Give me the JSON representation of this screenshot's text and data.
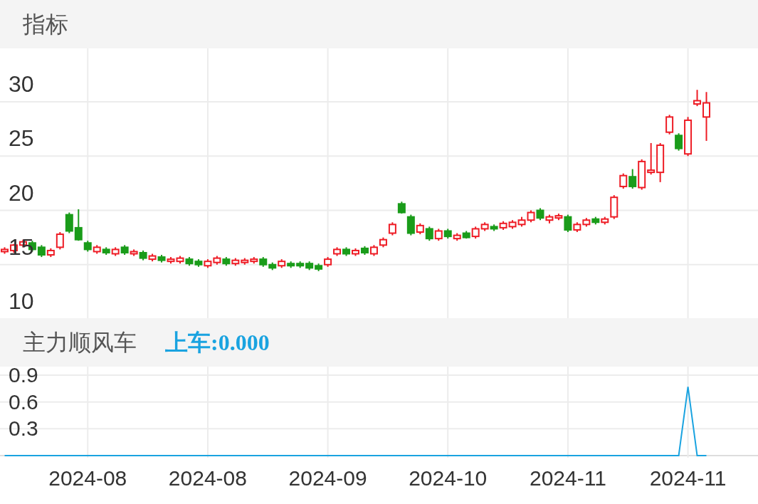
{
  "main_panel": {
    "title": "指标",
    "chart_data": {
      "type": "candlestick",
      "ylim": [
        10,
        30
      ],
      "yticks": [
        30,
        25,
        20,
        15,
        10
      ],
      "grid": true,
      "categories": [
        null,
        null,
        null,
        null,
        null,
        null,
        null,
        null,
        null,
        null,
        null,
        null,
        null,
        null,
        null,
        null,
        null,
        null,
        null,
        null,
        null,
        null,
        null,
        null,
        null,
        null,
        null,
        null,
        null,
        null,
        null,
        null,
        null,
        null,
        null,
        null,
        null,
        null,
        null,
        null,
        null,
        null,
        null,
        null,
        null,
        null,
        null,
        null,
        null,
        null,
        null,
        null,
        null,
        null,
        null,
        null,
        null,
        null,
        null,
        null,
        null,
        null,
        null,
        null,
        null,
        null,
        null,
        null,
        null,
        null,
        null,
        null,
        null,
        null,
        null,
        null,
        null
      ],
      "ohlc": [
        [
          16.2,
          16.6,
          16.0,
          16.4
        ],
        [
          16.3,
          16.9,
          16.1,
          16.8
        ],
        [
          16.8,
          17.3,
          16.6,
          17.1
        ],
        [
          17.0,
          17.2,
          16.2,
          16.4
        ],
        [
          16.6,
          16.8,
          15.7,
          15.9
        ],
        [
          15.9,
          16.5,
          15.7,
          16.3
        ],
        [
          16.6,
          18.0,
          16.4,
          17.8
        ],
        [
          19.6,
          19.8,
          17.9,
          18.1
        ],
        [
          18.4,
          20.1,
          17.2,
          17.3
        ],
        [
          17.0,
          17.2,
          16.2,
          16.4
        ],
        [
          16.2,
          16.8,
          16.0,
          16.6
        ],
        [
          16.4,
          16.6,
          15.9,
          16.1
        ],
        [
          16.0,
          16.6,
          15.8,
          16.4
        ],
        [
          16.6,
          16.8,
          15.9,
          16.1
        ],
        [
          16.0,
          16.4,
          15.8,
          16.2
        ],
        [
          16.1,
          16.3,
          15.4,
          15.6
        ],
        [
          15.5,
          16.0,
          15.3,
          15.8
        ],
        [
          15.7,
          15.9,
          15.2,
          15.4
        ],
        [
          15.3,
          15.7,
          15.1,
          15.5
        ],
        [
          15.3,
          15.8,
          15.1,
          15.6
        ],
        [
          15.5,
          15.7,
          14.9,
          15.1
        ],
        [
          15.3,
          15.5,
          14.8,
          15.0
        ],
        [
          14.9,
          15.5,
          14.7,
          15.3
        ],
        [
          15.2,
          15.8,
          15.0,
          15.6
        ],
        [
          15.5,
          15.7,
          14.9,
          15.1
        ],
        [
          15.1,
          15.6,
          14.9,
          15.4
        ],
        [
          15.2,
          15.6,
          15.0,
          15.4
        ],
        [
          15.3,
          15.7,
          15.1,
          15.5
        ],
        [
          15.5,
          15.7,
          14.8,
          15.0
        ],
        [
          15.0,
          15.2,
          14.5,
          14.7
        ],
        [
          14.9,
          15.5,
          14.7,
          15.3
        ],
        [
          15.1,
          15.3,
          14.7,
          14.9
        ],
        [
          15.1,
          15.3,
          14.7,
          14.9
        ],
        [
          15.1,
          15.3,
          14.5,
          14.7
        ],
        [
          14.9,
          15.1,
          14.4,
          14.6
        ],
        [
          15.0,
          15.7,
          14.8,
          15.5
        ],
        [
          16.0,
          16.6,
          15.8,
          16.4
        ],
        [
          16.4,
          16.6,
          15.8,
          16.0
        ],
        [
          16.0,
          16.5,
          15.8,
          16.3
        ],
        [
          16.5,
          16.7,
          15.9,
          16.1
        ],
        [
          16.0,
          16.8,
          15.8,
          16.6
        ],
        [
          16.8,
          17.5,
          16.6,
          17.3
        ],
        [
          17.9,
          18.9,
          17.7,
          18.7
        ],
        [
          20.6,
          20.8,
          19.7,
          19.8
        ],
        [
          19.4,
          19.6,
          17.7,
          17.9
        ],
        [
          18.0,
          18.8,
          17.8,
          18.6
        ],
        [
          18.3,
          18.5,
          17.2,
          17.4
        ],
        [
          17.4,
          18.3,
          17.2,
          18.1
        ],
        [
          18.1,
          18.3,
          17.4,
          17.6
        ],
        [
          17.4,
          17.9,
          17.2,
          17.7
        ],
        [
          17.9,
          18.1,
          17.4,
          17.5
        ],
        [
          17.6,
          18.5,
          17.4,
          18.3
        ],
        [
          18.3,
          18.9,
          18.1,
          18.7
        ],
        [
          18.5,
          18.7,
          18.1,
          18.3
        ],
        [
          18.4,
          19.0,
          18.2,
          18.8
        ],
        [
          18.5,
          19.1,
          18.3,
          18.9
        ],
        [
          18.7,
          19.4,
          18.5,
          19.1
        ],
        [
          19.1,
          20.0,
          18.9,
          19.8
        ],
        [
          20.0,
          20.2,
          19.1,
          19.3
        ],
        [
          19.1,
          19.6,
          18.8,
          19.4
        ],
        [
          19.3,
          19.7,
          19.1,
          19.5
        ],
        [
          19.4,
          19.6,
          18.0,
          18.2
        ],
        [
          18.2,
          18.9,
          18.0,
          18.7
        ],
        [
          18.7,
          19.3,
          18.5,
          19.1
        ],
        [
          19.2,
          19.4,
          18.7,
          18.9
        ],
        [
          18.9,
          19.4,
          18.7,
          19.2
        ],
        [
          19.4,
          21.4,
          19.2,
          21.2
        ],
        [
          22.2,
          23.4,
          22.0,
          23.2
        ],
        [
          23.1,
          23.8,
          22.0,
          22.2
        ],
        [
          22.1,
          24.7,
          21.9,
          24.5
        ],
        [
          23.5,
          26.2,
          23.3,
          23.7
        ],
        [
          23.5,
          26.2,
          22.6,
          26.0
        ],
        [
          27.2,
          28.8,
          27.0,
          28.6
        ],
        [
          26.9,
          27.1,
          25.5,
          25.7
        ],
        [
          25.2,
          28.6,
          25.0,
          28.3
        ],
        [
          29.8,
          31.1,
          29.6,
          30.1
        ],
        [
          28.6,
          30.9,
          26.4,
          29.9
        ]
      ]
    }
  },
  "sub_panel": {
    "title": "主力顺风车",
    "reading": "上车:0.000",
    "chart_data": {
      "type": "line",
      "ylim": [
        0,
        0.9
      ],
      "yticks": [
        0.3,
        0.6,
        0.9
      ],
      "grid": true,
      "categories": [
        null,
        null,
        null,
        null,
        null,
        null,
        null,
        null,
        null,
        "2024-08",
        null,
        null,
        null,
        null,
        null,
        null,
        null,
        null,
        null,
        null,
        null,
        null,
        "2024-08",
        null,
        null,
        null,
        null,
        null,
        null,
        null,
        null,
        null,
        null,
        null,
        null,
        "2024-09",
        null,
        null,
        null,
        null,
        null,
        null,
        null,
        null,
        null,
        null,
        null,
        null,
        "2024-10",
        null,
        null,
        null,
        null,
        null,
        null,
        null,
        null,
        null,
        null,
        null,
        null,
        "2024-11",
        null,
        null,
        null,
        null,
        null,
        null,
        null,
        null,
        null,
        null,
        null,
        null,
        "2024-11",
        null,
        null
      ],
      "series": [
        {
          "color": "#1aa3e0",
          "values": [
            0,
            0,
            0,
            0,
            0,
            0,
            0,
            0,
            0,
            0,
            0,
            0,
            0,
            0,
            0,
            0,
            0,
            0,
            0,
            0,
            0,
            0,
            0,
            0,
            0,
            0,
            0,
            0,
            0,
            0,
            0,
            0,
            0,
            0,
            0,
            0,
            0,
            0,
            0,
            0,
            0,
            0,
            0,
            0,
            0,
            0,
            0,
            0,
            0,
            0,
            0,
            0,
            0,
            0,
            0,
            0,
            0,
            0,
            0,
            0,
            0,
            0,
            0,
            0,
            0,
            0,
            0,
            0,
            0,
            0,
            0,
            0,
            0,
            0,
            0.77,
            0,
            0
          ]
        }
      ]
    }
  }
}
